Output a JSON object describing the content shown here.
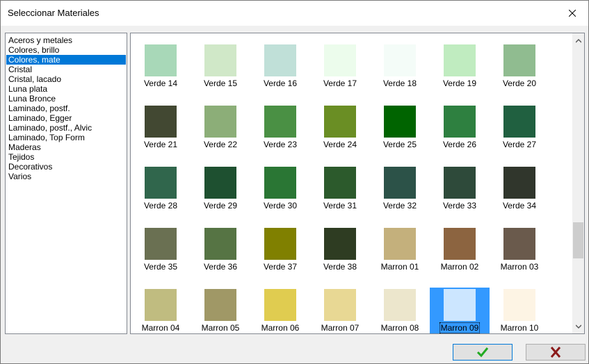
{
  "window": {
    "title": "Seleccionar Materiales"
  },
  "categories": [
    "Aceros y metales",
    "Colores, brillo",
    "Colores, mate",
    "Cristal",
    "Cristal, lacado",
    "Luna plata",
    "Luna Bronce",
    "Laminado, postf.",
    "Laminado, Egger",
    "Laminado, postf., Alvic",
    "Laminado, Top Form",
    "Maderas",
    "Tejidos",
    "Decorativos",
    "Varios"
  ],
  "selected_category": "Colores, mate",
  "swatches": [
    {
      "label": "Verde 14",
      "color": "#a8d8b8"
    },
    {
      "label": "Verde 15",
      "color": "#d0e8c8"
    },
    {
      "label": "Verde 16",
      "color": "#c0e0d8"
    },
    {
      "label": "Verde 17",
      "color": "#ecfcec"
    },
    {
      "label": "Verde 18",
      "color": "#f4fcf8"
    },
    {
      "label": "Verde 19",
      "color": "#c0ecc0"
    },
    {
      "label": "Verde 20",
      "color": "#90bc90"
    },
    {
      "label": "Verde 21",
      "color": "#424832"
    },
    {
      "label": "Verde 22",
      "color": "#8cae78"
    },
    {
      "label": "Verde 23",
      "color": "#4a9044"
    },
    {
      "label": "Verde 24",
      "color": "#6a8e24"
    },
    {
      "label": "Verde 25",
      "color": "#006400"
    },
    {
      "label": "Verde 26",
      "color": "#2e8040"
    },
    {
      "label": "Verde 27",
      "color": "#206040"
    },
    {
      "label": "Verde 28",
      "color": "#30664c"
    },
    {
      "label": "Verde 29",
      "color": "#1e5030"
    },
    {
      "label": "Verde 30",
      "color": "#2a7634"
    },
    {
      "label": "Verde 31",
      "color": "#2c5a2c"
    },
    {
      "label": "Verde 32",
      "color": "#2c5248"
    },
    {
      "label": "Verde 33",
      "color": "#2e4a3a"
    },
    {
      "label": "Verde 34",
      "color": "#30362c"
    },
    {
      "label": "Verde 35",
      "color": "#6a7052"
    },
    {
      "label": "Verde 36",
      "color": "#567444"
    },
    {
      "label": "Verde 37",
      "color": "#808000"
    },
    {
      "label": "Verde 38",
      "color": "#2e3c22"
    },
    {
      "label": "Marron 01",
      "color": "#c4b07c"
    },
    {
      "label": "Marron 02",
      "color": "#8c6440"
    },
    {
      "label": "Marron 03",
      "color": "#6a5a4c"
    },
    {
      "label": "Marron 04",
      "color": "#c0bc80"
    },
    {
      "label": "Marron 05",
      "color": "#a09866"
    },
    {
      "label": "Marron 06",
      "color": "#e0cc50"
    },
    {
      "label": "Marron 07",
      "color": "#e8d894"
    },
    {
      "label": "Marron 08",
      "color": "#ece6cc"
    },
    {
      "label": "Marron 09",
      "color": "#ffffff"
    },
    {
      "label": "Marron 10",
      "color": "#fdf4e4"
    }
  ],
  "selected_swatch": "Marron 09",
  "buttons": {
    "ok_icon": "checkmark-icon",
    "cancel_icon": "x-icon"
  },
  "colors": {
    "selection": "#0078d7",
    "ok_check": "#22aa22",
    "cancel_x": "#8b1a1a"
  }
}
